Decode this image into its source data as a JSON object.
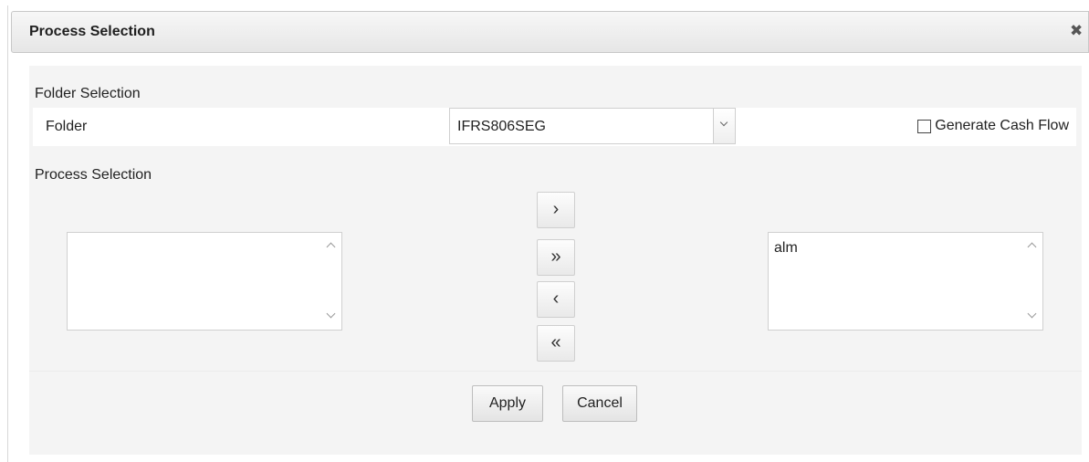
{
  "dialog": {
    "title": "Process Selection",
    "close_icon": "close-icon"
  },
  "folder_section": {
    "label": "Folder Selection",
    "folder_label": "Folder",
    "selected_folder": "IFRS806SEG",
    "dropdown_icon": "chevron-down-icon",
    "generate_cash_flow": {
      "label": "Generate Cash Flow",
      "checked": false
    }
  },
  "process_section": {
    "label": "Process Selection",
    "available_items": [],
    "selected_items": [
      "alm"
    ],
    "move_buttons": {
      "move_one": "›",
      "move_all": "»",
      "remove_one": "‹",
      "remove_all": "«"
    }
  },
  "footer": {
    "apply_label": "Apply",
    "cancel_label": "Cancel"
  }
}
